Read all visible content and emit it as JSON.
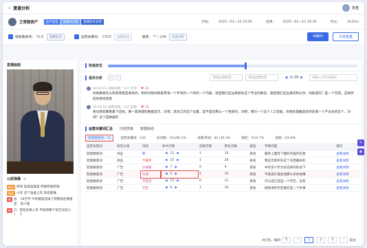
{
  "app": {
    "title": "复盘分析",
    "user_name": "复盘"
  },
  "header": {
    "shop_name": "王哥聊房产",
    "tags": [
      "主产品名",
      "直播间主题",
      "直播技术支持"
    ],
    "start_label": "开始：",
    "start_time": "2025—01—12 14:05",
    "end_label": "结束：",
    "end_time": "2025—01—12 16:30",
    "duration_label": "时长：",
    "duration": "2h25m"
  },
  "stats": {
    "violation_label": "智能敏感词：",
    "violation_value": "31次",
    "violation_btn": "查看标注",
    "keyword_label": "运营关键词：",
    "keyword_value": "236次",
    "keyword_btn": "查看标注",
    "tone_label": "语调：",
    "tone_value": "** / 分钟",
    "tone_btn": "点击分析",
    "ai_btn": "AI解AI",
    "review_btn": "分享复盘"
  },
  "left": {
    "video_title": "直播画面",
    "danmu_title": "公屏弹幕",
    "danmu": [
      {
        "badge": "粉丝",
        "badge_color": "orange",
        "user": "阿哥",
        "text": "黑黑黑黑黑 哎呦哎呦哎呦"
      },
      {
        "badge": "粉丝",
        "badge_color": "orange",
        "user": "小羊",
        "text": "这个准备上车 就近能做"
      },
      {
        "badge": "新",
        "badge_color": "red",
        "user": "谷友",
        "text": "18万学 今年都涨这样了吧我现在要值多少钱"
      },
      {
        "badge": "新",
        "badge_color": "red",
        "user": "刀*",
        "text": "现在好进入车 不知道哪个地方比较火了"
      }
    ]
  },
  "main": {
    "quick_locate_label": "快速定位",
    "timeline_progress": 0.55,
    "speech_label": "语术分析",
    "filter1_placeholder": "筛选分类标签",
    "filter2_placeholder": "筛选运营标签",
    "page_current": "4",
    "page_total": "/ 29",
    "search_placeholder": "请输入问话关键词",
    "segments": [
      {
        "speaker": "主播",
        "meta": "00:00:01  违规词语：12? 大学",
        "likes": "♥ 16",
        "text": "你如果要怎么转卖或者是来找你，和你对接你就能带来一个专项的一个好的一个内容，就是我们这边来给你这个专业的解答，就是我们这边来的和分享，你知道吗？是一个东西。这样然后你就会发现"
      },
      {
        "speaker": "主播",
        "meta": "00:00:05  运营词语：12? 自我",
        "likes": "♥ 16",
        "text": "各位网友都看着下这张。黄一套商铺的数据显示，对吧，黑龙江的这个位置，是不是在那么一个更新的，对吧，我们一个这个人工智能，你想生理推高房的话或一个产业总的这个，对吧？这个是数据的"
      }
    ],
    "table_tabs": [
      "运营关键词汇总",
      "内容梦森",
      "数据曲线"
    ],
    "summary": {
      "chip": "智能敏感词：31",
      "items": [
        "运营关键词：236",
        "总次数：101/66.2%",
        "总量/有效：82 (26.3%",
        "我的：11/4.7%",
        "违规：2/0.8%"
      ]
    },
    "table_headers": [
      "运营关键词",
      "标签分类",
      "词语",
      "命中次数",
      "违规次数",
      "转化次数",
      "类型",
      "字串内容",
      "操作"
    ],
    "rows": [
      {
        "a": "智能敏感词",
        "b": "商业",
        "c": "降",
        "d": "12",
        "e": "1",
        "f": "16",
        "g": "系统",
        "h": "最终上面有下面的内容的东西",
        "i": "查看详情"
      },
      {
        "a": "智能敏感词",
        "b": "商业",
        "c": "不要买",
        "d": "25",
        "e": "1",
        "f": "28",
        "g": "系统",
        "h": "我这次刚买的这个东西最好的",
        "i": "查看详情"
      },
      {
        "a": "智能敏感词",
        "b": "广告",
        "c": "价格最",
        "d": "7",
        "e": "0",
        "f": "9",
        "g": "系统",
        "h": "中考多少年为房这样的形式下",
        "i": "查看详情"
      },
      {
        "a": "智能敏感词",
        "b": "广告",
        "c": "升值",
        "d": "5",
        "e": "1",
        "f": "15",
        "g": "系统",
        "h": "不能说价值会涨那么多你会赚",
        "i": "查看详情"
      },
      {
        "a": "智能敏感词",
        "b": "广告",
        "c": "学区房",
        "d": "13",
        "e": "0",
        "f": "11",
        "g": "系统",
        "h": "可以说它就是一个学区，没有",
        "i": "查看详情"
      },
      {
        "a": "智能敏感词",
        "b": "广告",
        "c": "学区",
        "d": "9",
        "e": "1",
        "f": "16",
        "g": "系统",
        "h": "刚刚讲的学区确实是一个好事",
        "i": "查看详情"
      }
    ],
    "footer": {
      "total": "共3页，每页",
      "per_page": "5",
      "pages": [
        "1",
        "2",
        "3"
      ],
      "goto": "前往"
    }
  }
}
